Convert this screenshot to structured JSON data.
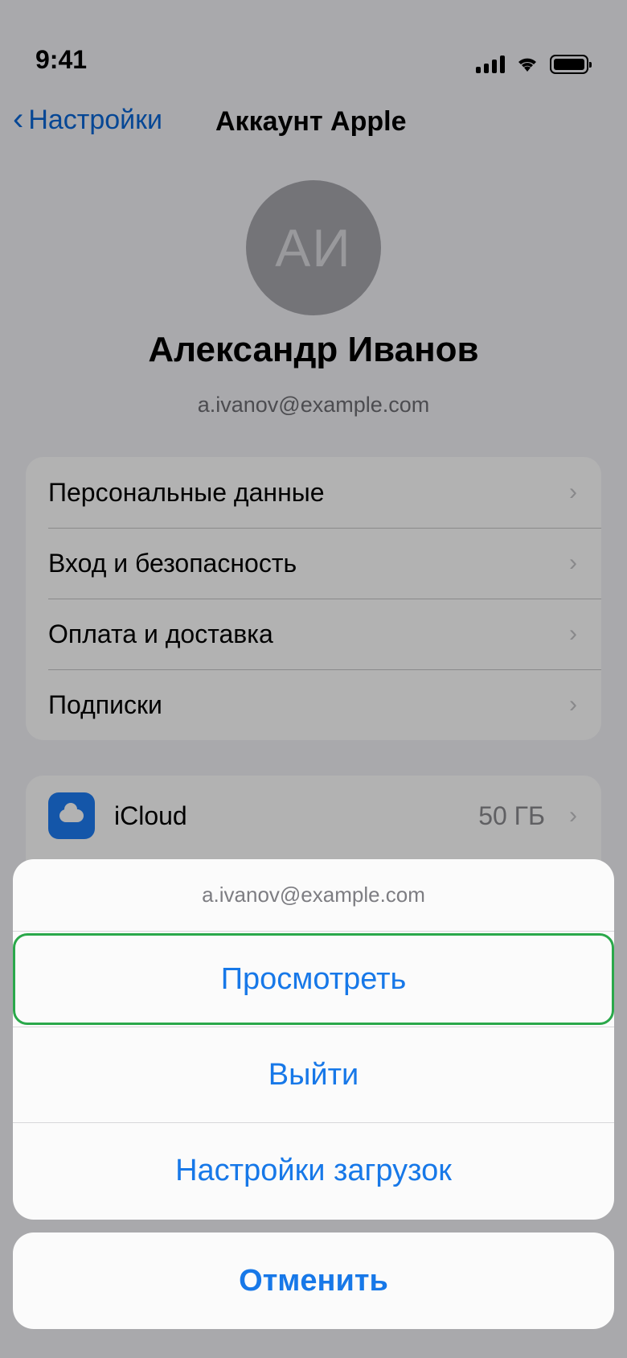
{
  "status": {
    "time": "9:41"
  },
  "nav": {
    "back_label": "Настройки",
    "back_chevron": "‹",
    "title": "Аккаунт Apple"
  },
  "profile": {
    "initials": "АИ",
    "name": "Александр Иванов",
    "email": "a.ivanov@example.com"
  },
  "settings_group": {
    "items": [
      {
        "label": "Персональные данные"
      },
      {
        "label": "Вход и безопасность"
      },
      {
        "label": "Оплата и доставка"
      },
      {
        "label": "Подписки"
      }
    ]
  },
  "services_group": {
    "items": [
      {
        "label": "iCloud",
        "value": "50 ГБ",
        "icon": "icloud-icon"
      }
    ]
  },
  "chevron": "›",
  "action_sheet": {
    "header": "a.ivanov@example.com",
    "buttons": [
      {
        "label": "Просмотреть",
        "highlighted": true
      },
      {
        "label": "Выйти"
      },
      {
        "label": "Настройки загрузок"
      }
    ],
    "cancel_label": "Отменить"
  },
  "colors": {
    "accent": "#1778e8",
    "highlight_border": "#2aa84a"
  }
}
